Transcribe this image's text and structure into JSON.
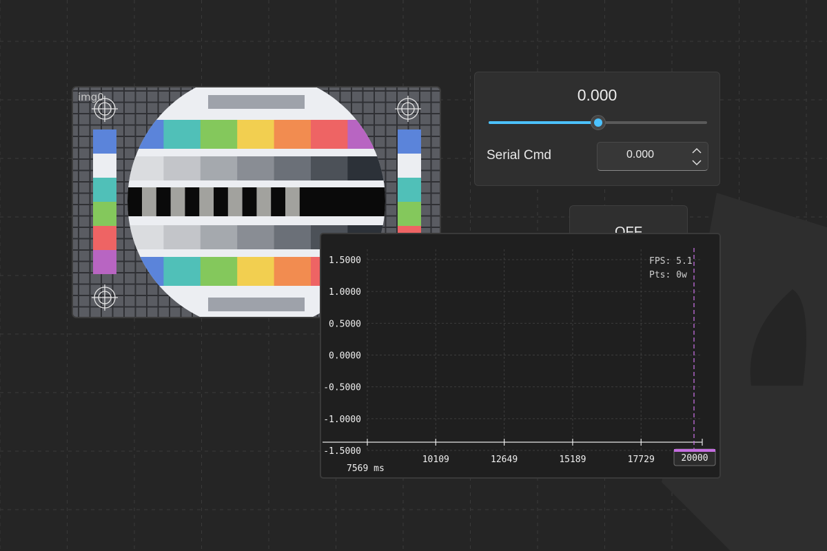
{
  "image_panel": {
    "label": "img0",
    "colors": {
      "blue": "#5b84da",
      "teal": "#50c0b8",
      "green": "#84c85c",
      "yellow": "#f2cf50",
      "orange": "#f28c50",
      "red": "#ee6464",
      "purple": "#b865c2",
      "white": "#eceef2",
      "grid": "#2f3034",
      "gray_bar": "#9ea2aa"
    },
    "gray_ramp": [
      "#dadcdf",
      "#c3c5c9",
      "#a5a9ae",
      "#898d94",
      "#6b7078",
      "#4c5158",
      "#2c3138"
    ]
  },
  "control": {
    "slider_value_text": "0.000",
    "slider_fraction": 0.5,
    "serial_label": "Serial Cmd",
    "spinbox_value": "0.000",
    "accent_color": "#4cc2ff"
  },
  "toggle_button": {
    "label": "OFF"
  },
  "plot": {
    "y_tick_labels": [
      "1.5000",
      "1.0000",
      "0.5000",
      "0.0000",
      "-0.5000",
      "-1.0000",
      "-1.5000"
    ],
    "x_tick_labels": [
      "10109",
      "12649",
      "15189",
      "17729"
    ],
    "x_start_label": "7569 ms",
    "x_end_label": "20000",
    "fps_text": "FPS: 5.1",
    "pts_text": "Pts: 0w",
    "cursor_color": "#c46ee0",
    "chart_data": {
      "type": "line",
      "series": [],
      "x_ticks": [
        7569,
        10109,
        12649,
        15189,
        17729,
        20000
      ],
      "y_ticks": [
        1.5,
        1.0,
        0.5,
        0.0,
        -0.5,
        -1.0,
        -1.5
      ],
      "xlim": [
        7569,
        20000
      ],
      "ylim": [
        -1.5,
        1.5
      ],
      "grid": true
    }
  }
}
